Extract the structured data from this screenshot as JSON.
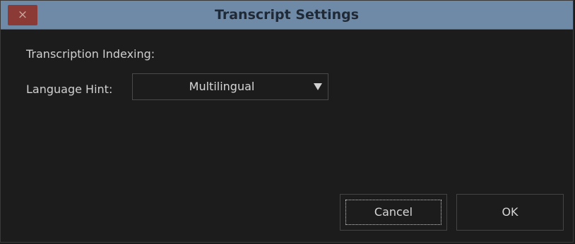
{
  "window": {
    "title": "Transcript Settings",
    "close_glyph": "×"
  },
  "content": {
    "section_label": "Transcription Indexing:",
    "language_hint_label": "Language Hint:",
    "language_hint_value": "Multilingual"
  },
  "buttons": {
    "cancel_label": "Cancel",
    "ok_label": "OK"
  },
  "colors": {
    "titlebar": "#6f8aa7",
    "close_button": "#8b3a35",
    "background": "#1c1c1c",
    "text": "#d0d0d0"
  },
  "icons": {
    "close": "close-icon",
    "dropdown": "chevron-down-icon"
  }
}
